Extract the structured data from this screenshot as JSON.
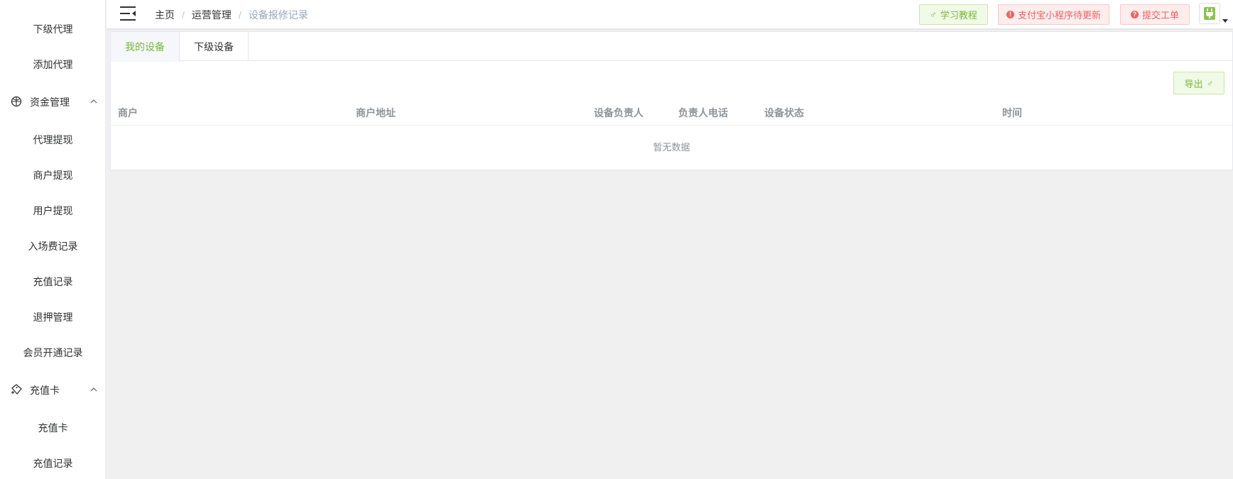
{
  "sidebar": {
    "items": [
      {
        "type": "item",
        "label": "下级代理"
      },
      {
        "type": "item",
        "label": "添加代理"
      },
      {
        "type": "group",
        "label": "资金管理",
        "icon": "fund-icon"
      },
      {
        "type": "item",
        "label": "代理提现"
      },
      {
        "type": "item",
        "label": "商户提现"
      },
      {
        "type": "item",
        "label": "用户提现"
      },
      {
        "type": "item",
        "label": "入场费记录"
      },
      {
        "type": "item",
        "label": "充值记录"
      },
      {
        "type": "item",
        "label": "退押管理"
      },
      {
        "type": "item",
        "label": "会员开通记录"
      },
      {
        "type": "group",
        "label": "充值卡",
        "icon": "card-icon"
      },
      {
        "type": "item",
        "label": "充值卡"
      },
      {
        "type": "item",
        "label": "充值记录"
      }
    ]
  },
  "header": {
    "breadcrumb": [
      "主页",
      "运营管理",
      "设备报修记录"
    ],
    "buttons": {
      "tutorial": "学习教程",
      "alipay_update": "支付宝小程序待更新",
      "ticket": "提交工单"
    }
  },
  "tabs": [
    "我的设备",
    "下级设备"
  ],
  "toolbar": {
    "export": "导出"
  },
  "table": {
    "columns": [
      "商户",
      "商户地址",
      "设备负责人",
      "负责人电话",
      "设备状态",
      "时间"
    ],
    "empty_text": "暂无数据"
  },
  "colors": {
    "accent_green": "#7ab83a",
    "danger_red": "#f06262",
    "breadcrumb_current": "#97a8be"
  }
}
